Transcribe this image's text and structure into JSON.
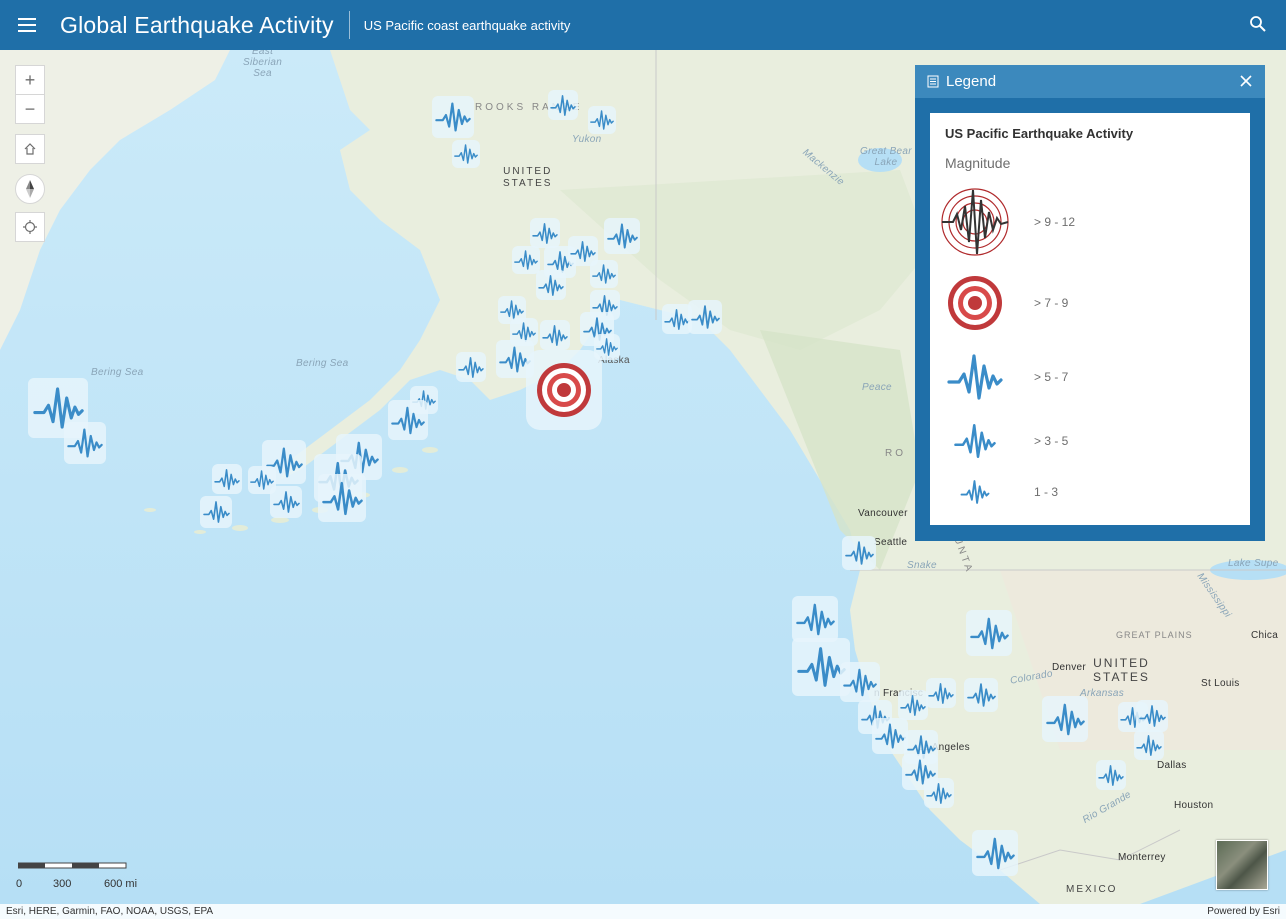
{
  "header": {
    "title": "Global Earthquake Activity",
    "subtitle": "US Pacific coast earthquake activity",
    "menu_icon": "hamburger-icon",
    "search_icon": "search-icon"
  },
  "map": {
    "place_labels": {
      "east_siberian_sea": "East\nSiberian\nSea",
      "brooks_range": "ROOKS RANGE",
      "yukon": "Yukon",
      "united_states_ak": "UNITED\nSTATES",
      "mackenzie": "Mackenzie",
      "great_bear_lake": "Great Bear\nLake",
      "bering_sea_1": "Bering Sea",
      "bering_sea_2": "Bering Sea",
      "alaska": "Alaska",
      "peace": "Peace",
      "rocky_fragment": "RO",
      "vancouver": "Vancouver",
      "seattle": "Seattle",
      "snake": "Snake",
      "mountains_fragment": "UNTA",
      "lake_superior": "Lake Supe",
      "mississippi": "Mississippi",
      "great_plains": "GREAT PLAINS",
      "chicago": "Chica",
      "denver": "Denver",
      "united_states": "UNITED\nSTATES",
      "colorado": "Colorado",
      "arkansas": "Arkansas",
      "st_louis": "St Louis",
      "san_francisco": "n Francisc",
      "los_angeles": "os Angeles",
      "dallas": "Dallas",
      "houston": "Houston",
      "rio_grande": "Rio Grande",
      "monterrey": "Monterrey",
      "mexico": "MEXICO"
    },
    "controls": {
      "zoom_in": "+",
      "zoom_out": "−"
    }
  },
  "legend": {
    "title": "Legend",
    "layer_title": "US Pacific Earthquake Activity",
    "field": "Magnitude",
    "classes": [
      {
        "label": "> 9 - 12",
        "symbol": "seismograph-target-icon"
      },
      {
        "label": "> 7 - 9",
        "symbol": "red-target-icon"
      },
      {
        "label": "> 5 - 7",
        "symbol": "seismic-wave-icon"
      },
      {
        "label": "> 3 - 5",
        "symbol": "seismic-wave-icon"
      },
      {
        "label": "1 - 3",
        "symbol": "seismic-wave-icon"
      }
    ],
    "colors": {
      "wave": "#3a8cc8",
      "target": "#c0393b",
      "header": "#1f6fa8"
    }
  },
  "scale": {
    "labels": [
      "0",
      "300",
      "600 mi"
    ]
  },
  "attribution": {
    "left": "Esri, HERE, Garmin, FAO, NOAA, USGS, EPA",
    "right": "Powered by Esri"
  }
}
